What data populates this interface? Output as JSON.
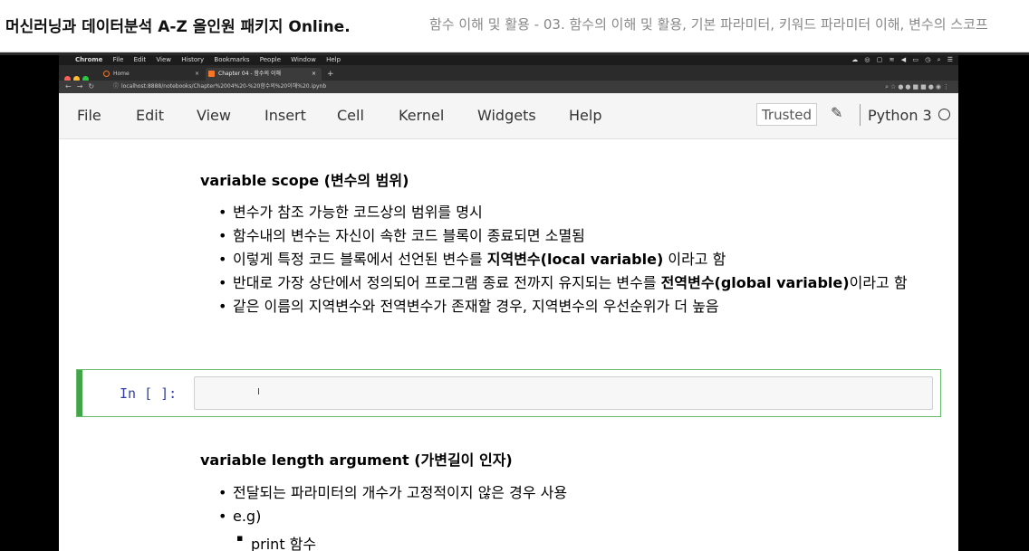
{
  "course": {
    "title": "머신러닝과 데이터분석 A-Z 올인원 패키지 Online.",
    "subtitle": "함수 이해 및 활용 - 03. 함수의 이해 및 활용, 기본 파라미터, 키워드 파라미터 이해, 변수의 스코프"
  },
  "mac_menu": {
    "items": [
      "Chrome",
      "File",
      "Edit",
      "View",
      "History",
      "Bookmarks",
      "People",
      "Window",
      "Help"
    ]
  },
  "browser": {
    "tabs": [
      {
        "label": "Home",
        "close": "×"
      },
      {
        "label": "Chapter 04 - 함수의 이해",
        "close": "×"
      }
    ],
    "new_tab": "+",
    "url": "localhost:8888/notebooks/Chapter%2004%20-%20함수의%20이해%20.ipynb"
  },
  "jupyter": {
    "menu": [
      "File",
      "Edit",
      "View",
      "Insert",
      "Cell",
      "Kernel",
      "Widgets",
      "Help"
    ],
    "trusted": "Trusted",
    "kernel": "Python 3"
  },
  "notebook": {
    "section1": {
      "heading": "variable scope (변수의 범위)",
      "b1": "변수가 참조 가능한 코드상의 범위를 명시",
      "b2": "함수내의 변수는 자신이 속한 코드 블록이 종료되면 소멸됨",
      "b3_pre": "이렇게 특정 코드 블록에서 선언된 변수를 ",
      "b3_bold": "지역변수(local variable)",
      "b3_post": " 이라고 함",
      "b4_pre": "반대로 가장 상단에서 정의되어 프로그램 종료 전까지 유지되는 변수를 ",
      "b4_bold": "전역변수(global variable)",
      "b4_post": "이라고 함",
      "b5": "같은 이름의 지역변수와 전역변수가 존재할 경우, 지역변수의 우선순위가 더 높음"
    },
    "cell": {
      "prompt": "In [ ]:",
      "cursor": "I"
    },
    "section2": {
      "heading": "variable length argument (가변길이 인자)",
      "b1": "전달되는 파라미터의 개수가 고정적이지 않은 경우 사용",
      "b2": "e.g)",
      "sub1": "print 함수"
    }
  },
  "colors": {
    "cell_border": "#66bb6a",
    "cell_bar": "#42a548",
    "prompt": "#303f9f"
  }
}
